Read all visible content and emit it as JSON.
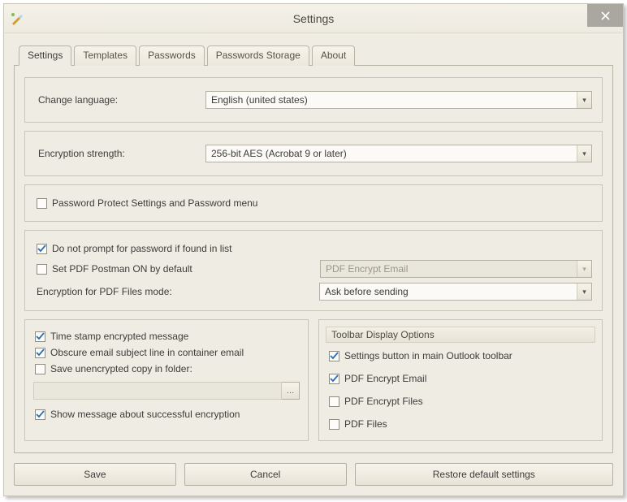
{
  "window": {
    "title": "Settings"
  },
  "tabs": {
    "settings": "Settings",
    "templates": "Templates",
    "passwords": "Passwords",
    "passwords_storage": "Passwords Storage",
    "about": "About"
  },
  "language": {
    "label": "Change language:",
    "value": "English (united states)"
  },
  "encryption": {
    "label": "Encryption strength:",
    "value": "256-bit AES (Acrobat 9 or later)"
  },
  "protect_settings": {
    "label": "Password Protect Settings and Password menu",
    "checked": false
  },
  "no_prompt": {
    "label": "Do not prompt for password if found in list",
    "checked": true
  },
  "postman_default": {
    "label": "Set PDF Postman ON by default",
    "checked": false
  },
  "postman_mode": {
    "value": "PDF Encrypt Email",
    "disabled": true
  },
  "files_mode": {
    "label": "Encryption for PDF Files mode:",
    "value": "Ask before sending"
  },
  "left_opts": {
    "timestamp": {
      "label": "Time stamp encrypted message",
      "checked": true
    },
    "obscure": {
      "label": "Obscure email subject line in container email",
      "checked": true
    },
    "save_copy": {
      "label": "Save unencrypted copy in folder:",
      "checked": false
    },
    "show_msg": {
      "label": "Show message about successful encryption",
      "checked": true
    }
  },
  "toolbar_opts": {
    "title": "Toolbar Display Options",
    "settings_btn": {
      "label": "Settings button in main Outlook toolbar",
      "checked": true
    },
    "encrypt_email": {
      "label": "PDF Encrypt Email",
      "checked": true
    },
    "encrypt_files": {
      "label": "PDF Encrypt Files",
      "checked": false
    },
    "pdf_files": {
      "label": "PDF Files",
      "checked": false
    }
  },
  "buttons": {
    "save": "Save",
    "cancel": "Cancel",
    "restore": "Restore default settings"
  }
}
